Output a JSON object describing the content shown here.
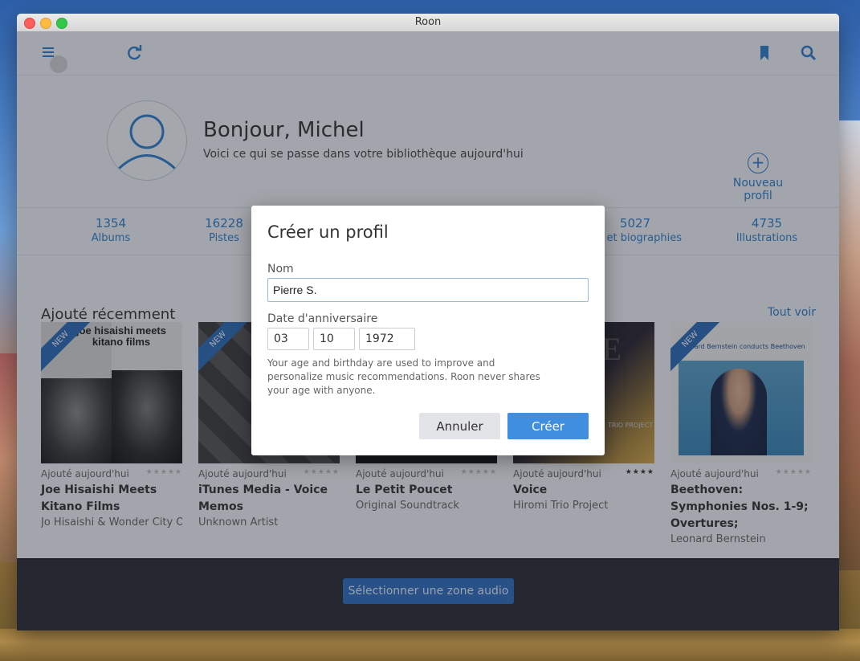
{
  "window": {
    "title": "Roon"
  },
  "toolbar": {
    "icons": [
      "menu-icon",
      "refresh-icon",
      "bookmark-icon",
      "search-icon"
    ]
  },
  "profile": {
    "greeting": "Bonjour, Michel",
    "subtitle": "Voici ce qui se passe dans votre bibliothèque aujourd'hui",
    "new_profile": "Nouveau profil"
  },
  "stats": [
    {
      "num": "1354",
      "label": "Albums"
    },
    {
      "num": "16228",
      "label": "Pistes"
    },
    {
      "num": "5027",
      "label": "ies et biographies"
    },
    {
      "num": "4735",
      "label": "Illustrations"
    }
  ],
  "recent": {
    "title": "Ajouté récemment",
    "see_all": "Tout voir",
    "albums": [
      {
        "added": "Ajouté aujourd'hui",
        "title": "Joe Hisaishi Meets Kitano Films",
        "artist": "Jo Hisaishi & Wonder City Or",
        "cover_text": "joe hisaishi meets kitano films",
        "badge": "NEW",
        "stars": "★★★★★",
        "rated": false
      },
      {
        "added": "Ajouté aujourd'hui",
        "title": "iTunes Media - Voice Memos",
        "artist": "Unknown Artist",
        "cover_text": "",
        "badge": "NEW",
        "stars": "★★★★★",
        "rated": false
      },
      {
        "added": "Ajouté aujourd'hui",
        "title": "Le Petit Poucet",
        "artist": "Original Soundtrack",
        "cover_text": "",
        "badge": "",
        "stars": "★★★★★",
        "rated": false
      },
      {
        "added": "Ajouté aujourd'hui",
        "title": "Voice",
        "artist": "Hiromi Trio Project",
        "cover_text": "TRIO PROJECT",
        "badge": "",
        "stars": "★★★★",
        "rated": true
      },
      {
        "added": "Ajouté aujourd'hui",
        "title": "Beethoven: Symphonies Nos. 1-9; Overtures;",
        "artist": "Leonard Bernstein",
        "cover_text": "Leonard Bernstein conducts Beethoven",
        "badge": "NEW",
        "stars": "★★★★★",
        "rated": false
      }
    ]
  },
  "footer": {
    "zone_button": "Sélectionner une zone audio"
  },
  "dialog": {
    "title": "Créer un profil",
    "name_label": "Nom",
    "name_value": "Pierre S.",
    "birthday_label": "Date d'anniversaire",
    "day": "03",
    "month": "10",
    "year": "1972",
    "note": "Your age and birthday are used to improve and personalize music recommendations. Roon never shares your age with anyone.",
    "cancel": "Annuler",
    "create": "Créer"
  },
  "colors": {
    "accent": "#2f7ecd",
    "create_button": "#3f8ee0",
    "footer": "#2a2d35"
  }
}
